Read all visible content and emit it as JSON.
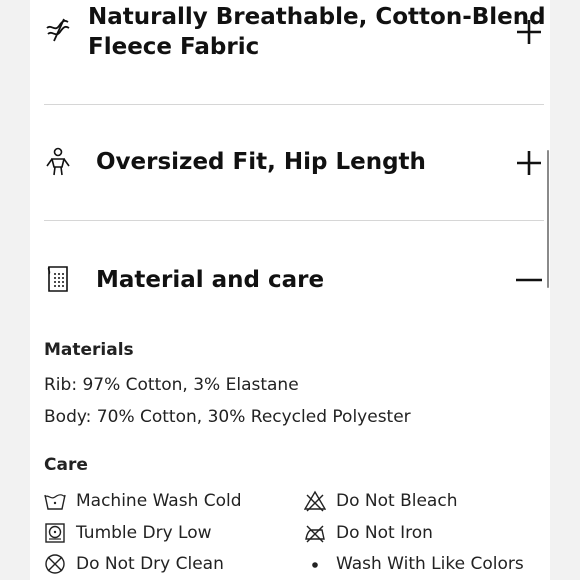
{
  "accordion": [
    {
      "title": "Naturally Breathable, Cotton-Blend Fleece Fabric",
      "title_line1": "Naturally Breathable, Cotton-Blend",
      "title_line2": "Fleece Fabric",
      "icon": "breathable-fabric-icon",
      "state": "collapsed",
      "toggle_icon": "plus-icon"
    },
    {
      "title": "Oversized Fit, Hip Length",
      "icon": "person-fit-icon",
      "state": "collapsed",
      "toggle_icon": "plus-icon"
    },
    {
      "title": "Material and care",
      "icon": "fabric-swatch-icon",
      "state": "expanded",
      "toggle_icon": "minus-icon"
    }
  ],
  "materials": {
    "heading": "Materials",
    "lines": [
      "Rib: 97% Cotton, 3% Elastane",
      "Body: 70% Cotton, 30% Recycled Polyester"
    ]
  },
  "care": {
    "heading": "Care",
    "items": [
      {
        "label": "Machine Wash Cold",
        "icon": "machine-wash-cold-icon"
      },
      {
        "label": "Do Not Bleach",
        "icon": "do-not-bleach-icon"
      },
      {
        "label": "Tumble Dry Low",
        "icon": "tumble-dry-low-icon"
      },
      {
        "label": "Do Not Iron",
        "icon": "do-not-iron-icon"
      },
      {
        "label": "Do Not Dry Clean",
        "icon": "do-not-dry-clean-icon"
      },
      {
        "label": "Wash With Like Colors",
        "icon": "bullet-icon"
      }
    ]
  },
  "colors": {
    "background": "#f2f2f2",
    "panel": "#ffffff",
    "text": "#111111",
    "divider": "#d6d6d6"
  }
}
